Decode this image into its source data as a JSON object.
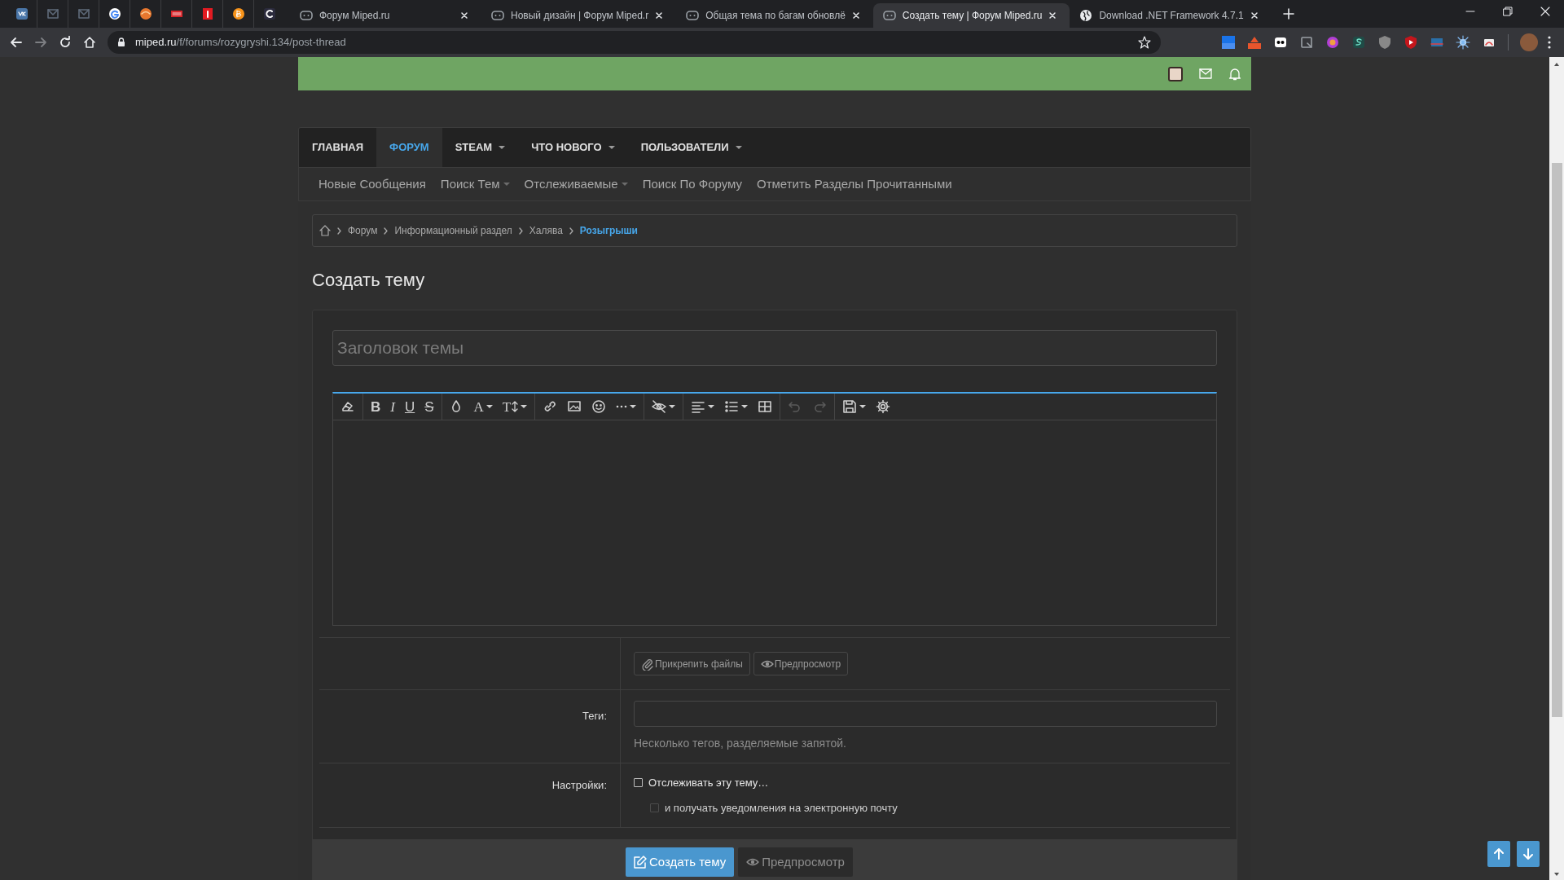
{
  "browser": {
    "tabs": [
      {
        "title": "Форум Miped.ru",
        "selected": false,
        "kind": "forum"
      },
      {
        "title": "Новый дизайн | Форум Miped.r",
        "selected": false,
        "kind": "forum"
      },
      {
        "title": "Общая тема по багам обновлё",
        "selected": false,
        "kind": "forum"
      },
      {
        "title": "Создать тему | Форум Miped.ru",
        "selected": true,
        "kind": "forum"
      },
      {
        "title": "Download .NET Framework 4.7.1",
        "selected": false,
        "kind": "web"
      }
    ],
    "address": {
      "domain": "miped.ru",
      "path": "/f/forums/rozygryshi.134/post-thread"
    }
  },
  "nav": {
    "tabs": [
      {
        "label": "ГЛАВНАЯ",
        "selected": false,
        "dropdown": false
      },
      {
        "label": "ФОРУМ",
        "selected": true,
        "dropdown": false
      },
      {
        "label": "STEAM",
        "selected": false,
        "dropdown": true
      },
      {
        "label": "ЧТО НОВОГО",
        "selected": false,
        "dropdown": true
      },
      {
        "label": "ПОЛЬЗОВАТЕЛИ",
        "selected": false,
        "dropdown": true
      }
    ]
  },
  "subnav": [
    {
      "label": "Новые Сообщения",
      "dropdown": false
    },
    {
      "label": "Поиск Тем",
      "dropdown": true
    },
    {
      "label": "Отслеживаемые",
      "dropdown": true
    },
    {
      "label": "Поиск По Форуму",
      "dropdown": false
    },
    {
      "label": "Отметить Разделы Прочитанными",
      "dropdown": false
    }
  ],
  "breadcrumbs": [
    {
      "label": "Форум",
      "current": false
    },
    {
      "label": "Информационный раздел",
      "current": false
    },
    {
      "label": "Халява",
      "current": false
    },
    {
      "label": "Розыгрыши",
      "current": true
    }
  ],
  "page_title": "Создать тему",
  "form": {
    "title_field": {
      "placeholder": "Заголовок темы"
    },
    "toolbar": [
      {
        "items": [
          {
            "kind": "eraser",
            "dropdown": false,
            "disabled": false
          }
        ]
      },
      {
        "items": [
          {
            "kind": "bold",
            "label": "B",
            "dropdown": false,
            "disabled": false
          },
          {
            "kind": "italic",
            "label": "I",
            "dropdown": false,
            "disabled": false
          },
          {
            "kind": "underline",
            "label": "U",
            "dropdown": false,
            "disabled": false
          },
          {
            "kind": "strike",
            "label": "S",
            "dropdown": false,
            "disabled": false
          }
        ]
      },
      {
        "items": [
          {
            "kind": "color",
            "dropdown": false,
            "disabled": false
          },
          {
            "kind": "font",
            "label": "A",
            "dropdown": true,
            "disabled": false
          },
          {
            "kind": "size",
            "label": "T",
            "dropdown": true,
            "disabled": false
          }
        ]
      },
      {
        "items": [
          {
            "kind": "link",
            "dropdown": false,
            "disabled": false
          },
          {
            "kind": "image",
            "dropdown": false,
            "disabled": false
          },
          {
            "kind": "smilie",
            "dropdown": false,
            "disabled": false
          },
          {
            "kind": "more",
            "dropdown": true,
            "disabled": false
          }
        ]
      },
      {
        "items": [
          {
            "kind": "hide",
            "dropdown": true,
            "disabled": false
          }
        ]
      },
      {
        "items": [
          {
            "kind": "align",
            "dropdown": true,
            "disabled": false
          },
          {
            "kind": "list",
            "dropdown": true,
            "disabled": false
          },
          {
            "kind": "table",
            "dropdown": false,
            "disabled": false
          }
        ]
      },
      {
        "items": [
          {
            "kind": "undo",
            "dropdown": false,
            "disabled": true
          },
          {
            "kind": "redo",
            "dropdown": false,
            "disabled": true
          }
        ]
      },
      {
        "items": [
          {
            "kind": "save",
            "dropdown": true,
            "disabled": false
          },
          {
            "kind": "settings",
            "dropdown": false,
            "disabled": false
          }
        ]
      }
    ],
    "attach_buttons": [
      {
        "label": "Прикрепить файлы",
        "kind": "attach"
      },
      {
        "label": "Предпросмотр",
        "kind": "preview"
      }
    ],
    "tags": {
      "label": "Теги:",
      "hint": "Несколько тегов, разделяемые запятой."
    },
    "settings": {
      "label": "Настройки:",
      "options": [
        {
          "label": "Отслеживать эту тему…",
          "checked": false,
          "disabled": false
        },
        {
          "label": "и получать уведомления на электронную почту",
          "checked": false,
          "disabled": true
        }
      ]
    },
    "actions": [
      {
        "label": "Создать тему",
        "kind": "primary"
      },
      {
        "label": "Предпросмотр",
        "kind": "secondary"
      }
    ]
  }
}
